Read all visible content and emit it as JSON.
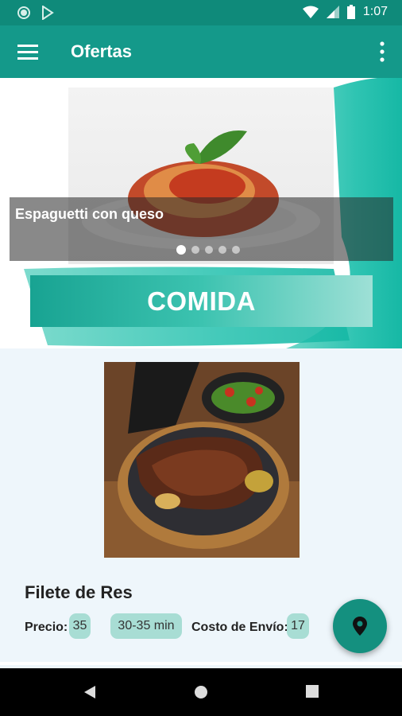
{
  "status_bar": {
    "time": "1:07"
  },
  "app_bar": {
    "title": "Ofertas"
  },
  "carousel": {
    "caption": "Espaguetti con queso",
    "slide_count": 5,
    "active_index": 0
  },
  "category": {
    "label": "COMIDA"
  },
  "item": {
    "name": "Filete de Res",
    "price_label": "Precio:",
    "price": "35",
    "time": "30-35 min",
    "shipping_label": "Costo de Envío:",
    "shipping": "17"
  },
  "colors": {
    "primary": "#14998a",
    "status": "#0f8a7a",
    "pill": "#a8ddd4",
    "fab": "#14907f"
  }
}
